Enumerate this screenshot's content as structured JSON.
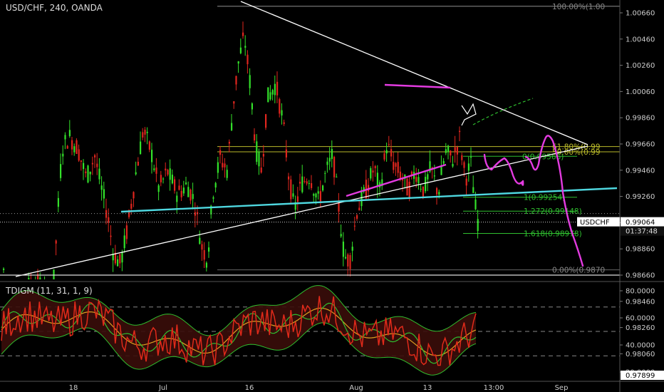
{
  "header": {
    "title": "USD/CHF, 240, OANDA"
  },
  "indicator": {
    "title": "TDIGM (11, 31, 1, 9)"
  },
  "chart_data": [
    {
      "type": "candlestick",
      "title": "USD/CHF, 240, OANDA",
      "symbol": "USDCHF",
      "ylim": [
        0.97899,
        1.00711
      ],
      "y_ticks": [
        1.0066,
        1.0046,
        1.0026,
        1.0006,
        0.9986,
        0.9966,
        0.9946,
        0.9926,
        0.9906,
        0.9886,
        0.9866,
        0.9846,
        0.9826,
        0.9806
      ],
      "y_tick_labels": [
        "1.00660",
        "1.00460",
        "1.00260",
        "1.00060",
        "0.99860",
        "0.99660",
        "0.99460",
        "0.99260",
        "0.99060",
        "0.98860",
        "0.98660",
        "0.98460",
        "0.98260",
        "0.98060"
      ],
      "x_tick_labels": [
        "18",
        "Jul",
        "16",
        "Aug",
        "13",
        "13:00",
        "Sep"
      ],
      "current_price": {
        "label": "USDCHF",
        "value": "0.99064",
        "countdown": "01:37:48"
      },
      "low_price_tag": "0.97899",
      "fibonacci": [
        {
          "label": "100.00%(1.00",
          "value": 1.0071
        },
        {
          "label": "61.80%(0.99",
          "value": 0.9964
        },
        {
          "label": "50.00%(0.99",
          "value": 0.996
        },
        {
          "label": "0.00%(0.9870",
          "value": 0.987
        }
      ],
      "extension": [
        {
          "label": "0(0.99566)",
          "value": 0.99566
        },
        {
          "label": "1(0.99254)",
          "value": 0.99254
        },
        {
          "label": "1.272(0.99148)",
          "value": 0.99148
        },
        {
          "label": "1.618(0.98978)",
          "value": 0.98978
        }
      ],
      "colors": {
        "up": "#33e02a",
        "down": "#e0261e",
        "fib": "#b9b92a",
        "extension": "#2fbe2f",
        "trendline": "#ffffff",
        "support": "#4fd8e0",
        "projection": "#e33be0"
      }
    },
    {
      "type": "line",
      "title": "TDIGM (11, 31, 1, 9)",
      "y_ticks": [
        80,
        60,
        40,
        20
      ],
      "y_tick_labels": [
        "80.0000",
        "60.0000",
        "40.0000",
        "20.0000"
      ],
      "levels": [
        68,
        50,
        32
      ],
      "series": [
        {
          "color": "#e02a1a"
        },
        {
          "color": "#2fbe2f"
        },
        {
          "color": "#e0a020"
        }
      ]
    }
  ]
}
